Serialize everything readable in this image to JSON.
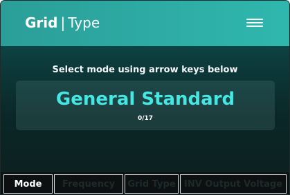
{
  "header": {
    "brand": "Grid",
    "separator": "|",
    "section": "Type",
    "menu_icon": "hamburger-menu-icon"
  },
  "selector": {
    "instruction": "Select mode using arrow keys below",
    "current_mode": "General Standard",
    "index_display": "0/17"
  },
  "tabs": [
    {
      "label": "Mode",
      "active": true
    },
    {
      "label": "Frequency",
      "active": false
    },
    {
      "label": "Grid Type",
      "active": false
    },
    {
      "label": "INV Output Voltage",
      "active": false
    }
  ],
  "colors": {
    "header_accent": "#2da9a2",
    "mode_text": "#46e6e3",
    "background": "#0c1e1f"
  }
}
